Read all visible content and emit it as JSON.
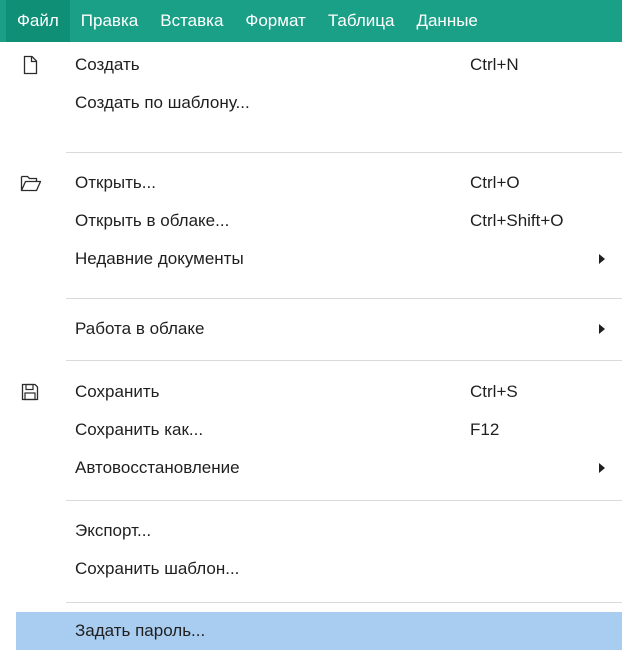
{
  "menubar": {
    "items": [
      "Файл",
      "Правка",
      "Вставка",
      "Формат",
      "Таблица",
      "Данные"
    ],
    "active_index": 0
  },
  "menu": {
    "create": {
      "label": "Создать",
      "shortcut": "Ctrl+N",
      "icon": "new-document-icon"
    },
    "create_from_template": {
      "label": "Создать по шаблону..."
    },
    "open": {
      "label": "Открыть...",
      "shortcut": "Ctrl+O",
      "icon": "open-folder-icon"
    },
    "open_in_cloud": {
      "label": "Открыть в облаке...",
      "shortcut": "Ctrl+Shift+O"
    },
    "recent_documents": {
      "label": "Недавние документы",
      "submenu": true
    },
    "cloud_work": {
      "label": "Работа в облаке",
      "submenu": true
    },
    "save": {
      "label": "Сохранить",
      "shortcut": "Ctrl+S",
      "icon": "save-disk-icon"
    },
    "save_as": {
      "label": "Сохранить как...",
      "shortcut": "F12"
    },
    "autorecovery": {
      "label": "Автовосстановление",
      "submenu": true
    },
    "export": {
      "label": "Экспорт..."
    },
    "save_template": {
      "label": "Сохранить шаблон..."
    },
    "set_password": {
      "label": "Задать пароль...",
      "highlighted": true
    }
  },
  "colors": {
    "menubar_bg": "#1aa087",
    "menubar_active_bg": "#0f8f76",
    "highlight_bg": "#a9cdf0"
  }
}
